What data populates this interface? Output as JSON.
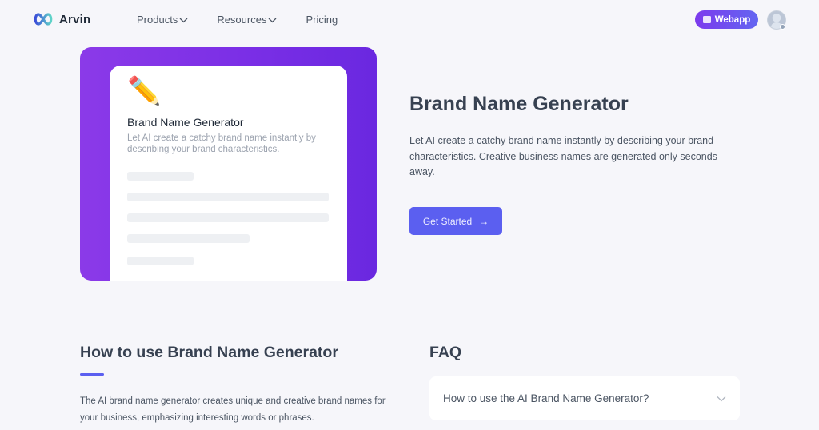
{
  "nav": {
    "brand": "Arvin",
    "links": [
      {
        "label": "Products",
        "has_dropdown": true
      },
      {
        "label": "Resources",
        "has_dropdown": true
      },
      {
        "label": "Pricing",
        "has_dropdown": false
      }
    ],
    "webapp_label": "Webapp",
    "icons": {
      "logo": "infinity-logo-icon",
      "webapp": "webapp-icon",
      "avatar": "user-avatar-icon"
    }
  },
  "hero": {
    "preview_card": {
      "emoji": "✏️",
      "title": "Brand Name Generator",
      "description": "Let AI create a catchy brand name instantly by describing your brand characteristics."
    },
    "title": "Brand Name Generator",
    "description": "Let AI create a catchy brand name instantly by describing your brand characteristics. Creative business names are generated only seconds away.",
    "cta_label": "Get Started",
    "cta_icon": "→"
  },
  "how_to": {
    "title": "How to use Brand Name Generator",
    "description": "The AI brand name generator creates unique and creative brand names for your business, emphasizing interesting words or phrases."
  },
  "faq": {
    "title": "FAQ",
    "items": [
      {
        "question": "How to use the AI Brand Name Generator?",
        "expanded": false
      }
    ]
  },
  "colors": {
    "accent": "#5b5ff0",
    "hero_gradient_start": "#8b3ae8",
    "hero_gradient_end": "#6a28e0",
    "background": "#f6f6fa"
  }
}
